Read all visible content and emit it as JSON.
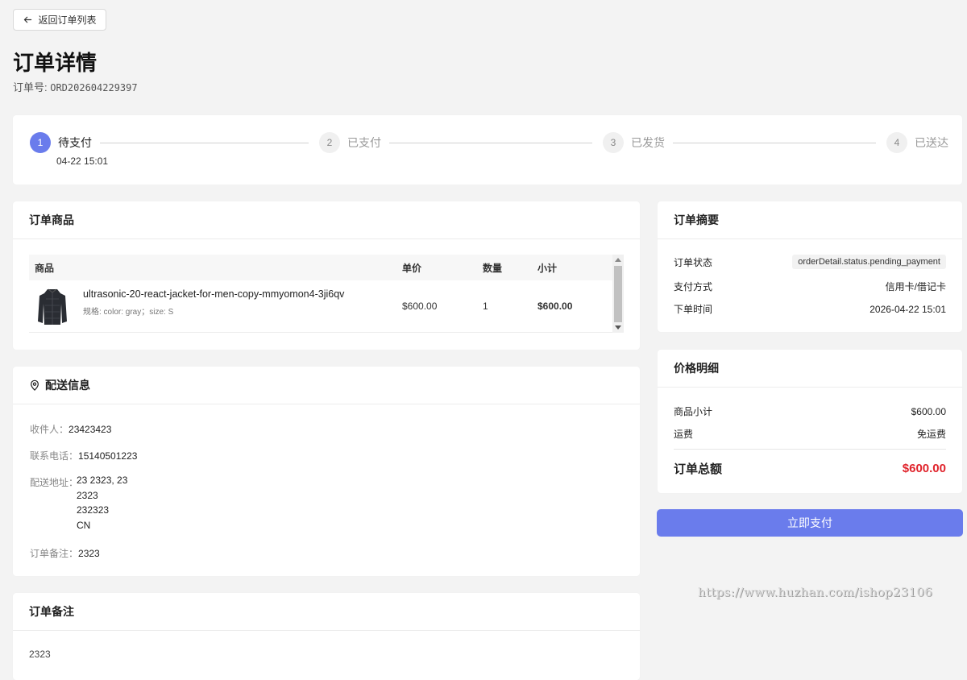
{
  "back_button": {
    "label": "返回订单列表"
  },
  "page": {
    "title": "订单详情",
    "order_no_label": "订单号: ",
    "order_no": "ORD202604229397"
  },
  "steps": [
    {
      "index": "1",
      "label": "待支付",
      "time": "04-22 15:01",
      "active": true
    },
    {
      "index": "2",
      "label": "已支付"
    },
    {
      "index": "3",
      "label": "已发货"
    },
    {
      "index": "4",
      "label": "已送达"
    }
  ],
  "items": {
    "title": "订单商品",
    "columns": [
      "商品",
      "单价",
      "数量",
      "小计"
    ],
    "rows": [
      {
        "name": "ultrasonic-20-react-jacket-for-men-copy-mmyomon4-3ji6qv",
        "spec": "规格: color: gray；size: S",
        "price": "$600.00",
        "qty": "1",
        "subtotal": "$600.00"
      }
    ]
  },
  "shipping": {
    "title": "配送信息",
    "recipient_label": "收件人：",
    "recipient": "23423423",
    "phone_label": "联系电话：",
    "phone": "15140501223",
    "address_label": "配送地址：",
    "address_lines": [
      "23 2323, 23",
      "2323",
      "232323",
      "CN"
    ],
    "remark_label": "订单备注：",
    "remark": "2323"
  },
  "note": {
    "title": "订单备注",
    "text": "2323"
  },
  "summary": {
    "title": "订单摘要",
    "status_label": "订单状态",
    "status_value": "orderDetail.status.pending_payment",
    "payment_label": "支付方式",
    "payment_value": "信用卡/借记卡",
    "time_label": "下单时间",
    "time_value": "2026-04-22 15:01"
  },
  "price_detail": {
    "title": "价格明细",
    "subtotal_label": "商品小计",
    "subtotal_value": "$600.00",
    "shipping_label": "运费",
    "shipping_value": "免运费",
    "total_label": "订单总额",
    "total_value": "$600.00"
  },
  "pay_button": {
    "label": "立即支付"
  },
  "watermark": "https://www.huzhan.com/ishop23106",
  "colors": {
    "accent": "#6a7cec",
    "total": "#e0242c"
  }
}
